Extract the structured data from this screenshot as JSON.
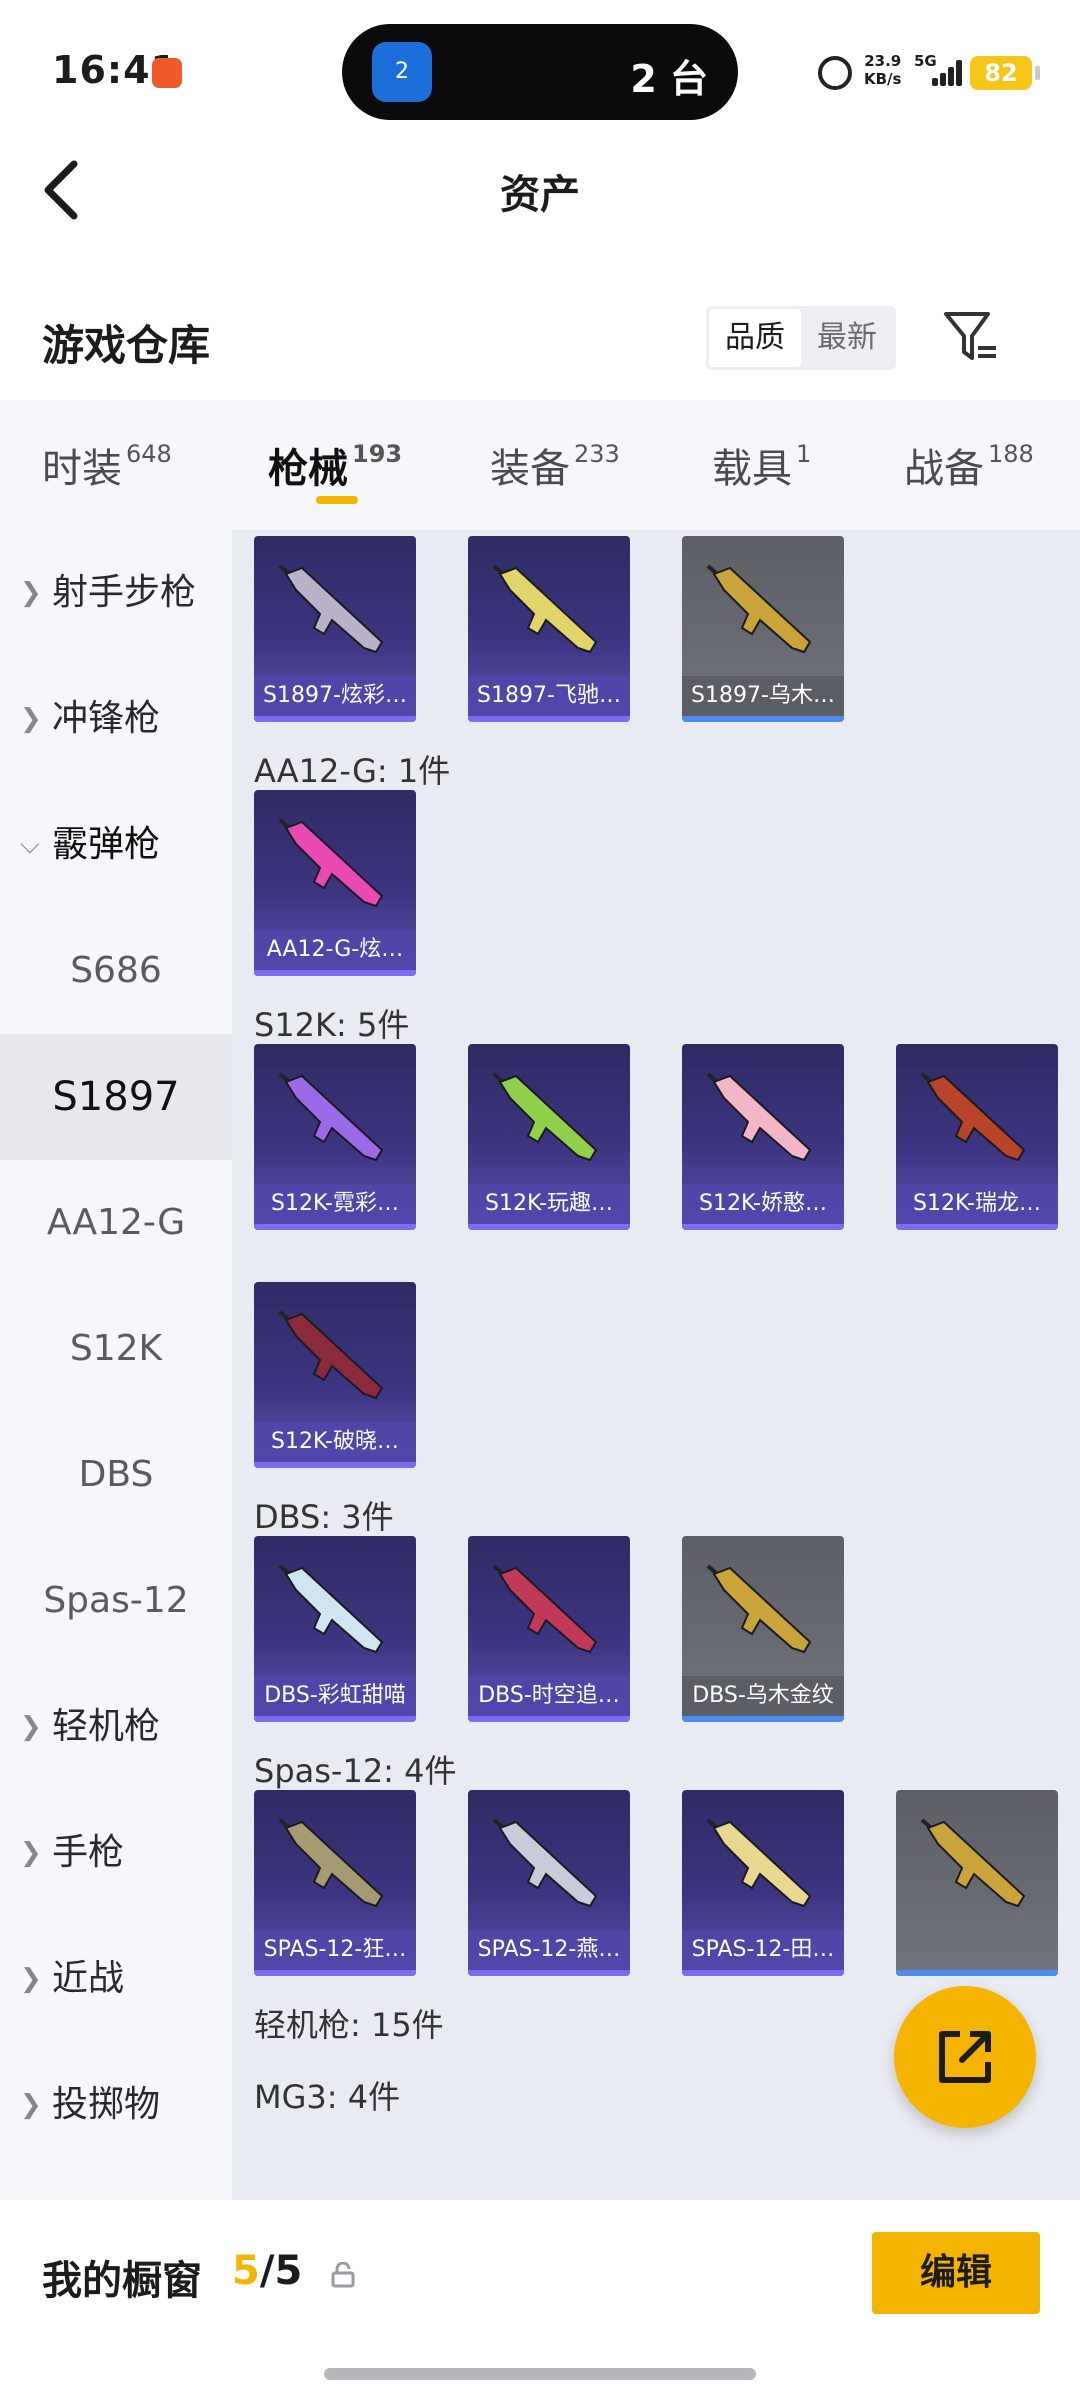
{
  "status_bar": {
    "time": "16:41",
    "island_icon_text": "2",
    "island_text": "2 台",
    "net_speed": "23.9",
    "net_speed_unit": "KB/s",
    "network": "5G",
    "battery": "82"
  },
  "header": {
    "title": "资产"
  },
  "section": {
    "title": "游戏仓库",
    "sort_quality": "品质",
    "sort_newest": "最新"
  },
  "tabs": [
    {
      "label": "时装",
      "count": "648"
    },
    {
      "label": "枪械",
      "count": "193"
    },
    {
      "label": "装备",
      "count": "233"
    },
    {
      "label": "载具",
      "count": "1"
    },
    {
      "label": "战备",
      "count": "188"
    }
  ],
  "sidebar": {
    "items": [
      {
        "label": "射手步枪",
        "kind": "group"
      },
      {
        "label": "冲锋枪",
        "kind": "group"
      },
      {
        "label": "霰弹枪",
        "kind": "group-open"
      },
      {
        "label": "S686",
        "kind": "sub"
      },
      {
        "label": "S1897",
        "kind": "sub-selected"
      },
      {
        "label": "AA12-G",
        "kind": "sub"
      },
      {
        "label": "S12K",
        "kind": "sub"
      },
      {
        "label": "DBS",
        "kind": "sub"
      },
      {
        "label": "Spas-12",
        "kind": "sub"
      },
      {
        "label": "轻机枪",
        "kind": "group"
      },
      {
        "label": "手枪",
        "kind": "group"
      },
      {
        "label": "近战",
        "kind": "group"
      },
      {
        "label": "投掷物",
        "kind": "group"
      }
    ]
  },
  "content": {
    "groups": [
      {
        "label": "",
        "items": [
          {
            "name": "S1897-炫彩…",
            "tier": "purple",
            "color": "#b9b2c8"
          },
          {
            "name": "S1897-飞驰…",
            "tier": "purple",
            "color": "#e0d46a"
          },
          {
            "name": "S1897-乌木…",
            "tier": "gray",
            "color": "#c9a43a"
          }
        ]
      },
      {
        "label": "AA12-G: 1件",
        "items": [
          {
            "name": "AA12-G-炫…",
            "tier": "purple",
            "color": "#e84ab0"
          }
        ]
      },
      {
        "label": "S12K: 5件",
        "items": [
          {
            "name": "S12K-霓彩…",
            "tier": "purple",
            "color": "#9b6ae8"
          },
          {
            "name": "S12K-玩趣…",
            "tier": "purple",
            "color": "#8fd14a"
          },
          {
            "name": "S12K-娇憨…",
            "tier": "purple",
            "color": "#f2b6c8"
          },
          {
            "name": "S12K-瑞龙…",
            "tier": "purple",
            "color": "#b8452a"
          },
          {
            "name": "S12K-破晓…",
            "tier": "purple",
            "color": "#8a2a3a"
          }
        ]
      },
      {
        "label": "DBS: 3件",
        "items": [
          {
            "name": "DBS-彩虹甜喵",
            "tier": "purple",
            "color": "#cfe6f2"
          },
          {
            "name": "DBS-时空追…",
            "tier": "purple",
            "color": "#c23a5a"
          },
          {
            "name": "DBS-乌木金纹",
            "tier": "gray",
            "color": "#c9a43a"
          }
        ]
      },
      {
        "label": "Spas-12: 4件",
        "items": [
          {
            "name": "SPAS-12-狂…",
            "tier": "purple",
            "color": "#a89a70"
          },
          {
            "name": "SPAS-12-燕…",
            "tier": "purple",
            "color": "#c8ccd8"
          },
          {
            "name": "SPAS-12-田…",
            "tier": "purple",
            "color": "#e8d890"
          },
          {
            "name": "",
            "tier": "gray",
            "color": "#c9a43a"
          }
        ]
      },
      {
        "label": "轻机枪: 15件",
        "items": []
      },
      {
        "label": "MG3: 4件",
        "items": []
      }
    ]
  },
  "bottom_bar": {
    "label": "我的橱窗",
    "count_current": "5",
    "count_sep": "/",
    "count_total": "5",
    "edit_label": "编辑"
  },
  "icons": {
    "back": "back-arrow-icon",
    "filter": "filter-icon",
    "lock": "lock-icon",
    "share": "share-icon",
    "accent": "#f5b400"
  }
}
